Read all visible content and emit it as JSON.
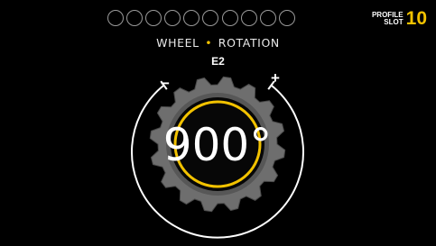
{
  "header": {
    "profile_slot_label_line1": "PROFILE",
    "profile_slot_label_line2": "SLOT",
    "profile_slot_number": "10",
    "slot_dot_count": 10
  },
  "setting": {
    "title_part1": "WHEEL",
    "title_separator": "•",
    "title_part2": "ROTATION",
    "mode": "E2",
    "value": "900°",
    "decrease_label": "−",
    "increase_label": "+"
  },
  "colors": {
    "accent": "#f2c200",
    "background": "#000000",
    "knob_gray": "#6e6e6e",
    "slot_dot_outline": "#9a9a9a"
  }
}
